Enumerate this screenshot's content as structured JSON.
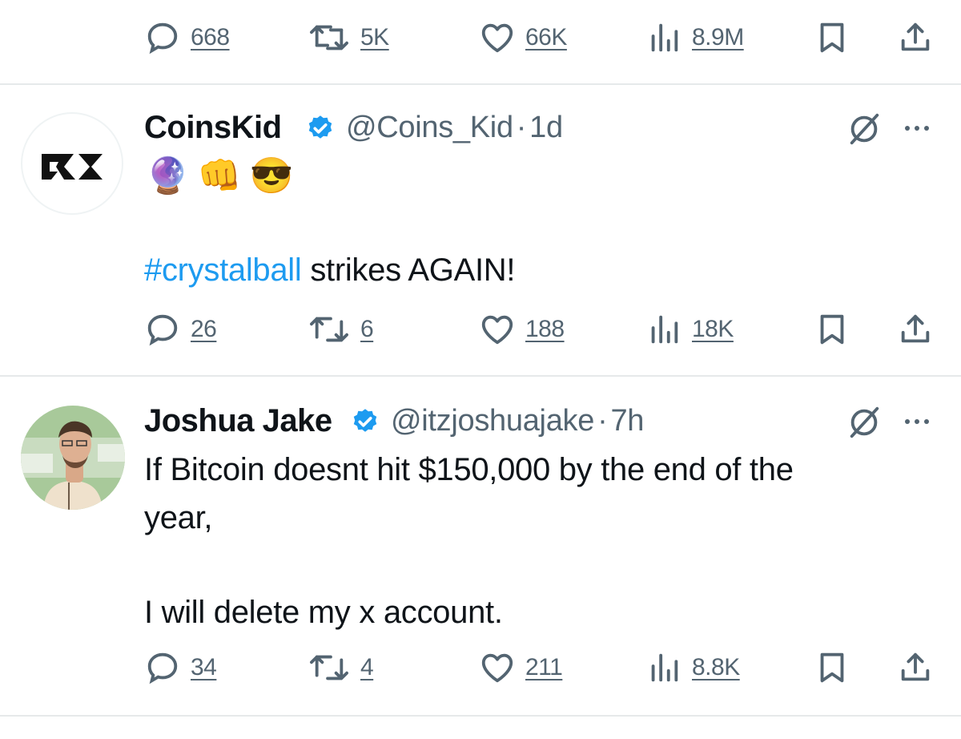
{
  "top_tweet": {
    "replies": "668",
    "reposts": "5K",
    "likes": "66K",
    "views": "8.9M"
  },
  "tweets": [
    {
      "name": "CoinsKid",
      "handle": "@Coins_Kid",
      "time": "1d",
      "avatar_text": "CK",
      "emojis": [
        "🔮",
        "👊",
        "😎"
      ],
      "hashtag": "#crystalball",
      "text": "strikes AGAIN!",
      "replies": "26",
      "reposts": "6",
      "likes": "188",
      "views": "18K"
    },
    {
      "name": "Joshua Jake",
      "handle": "@itzjoshuajake",
      "time": "7h",
      "lines": [
        "If Bitcoin doesnt hit $150,000 by the end of the",
        "year,",
        "",
        "I will delete my x account."
      ],
      "replies": "34",
      "reposts": "4",
      "likes": "211",
      "views": "8.8K"
    }
  ],
  "sep": "·",
  "colors": {
    "text": "#0f1419",
    "secondary": "#536471",
    "accent": "#1d9bf0",
    "divider": "#e6e9ea"
  },
  "icons": [
    "reply-icon",
    "repost-icon",
    "like-icon",
    "views-icon",
    "bookmark-icon",
    "share-icon",
    "verified-badge-icon",
    "grok-icon",
    "more-icon"
  ]
}
